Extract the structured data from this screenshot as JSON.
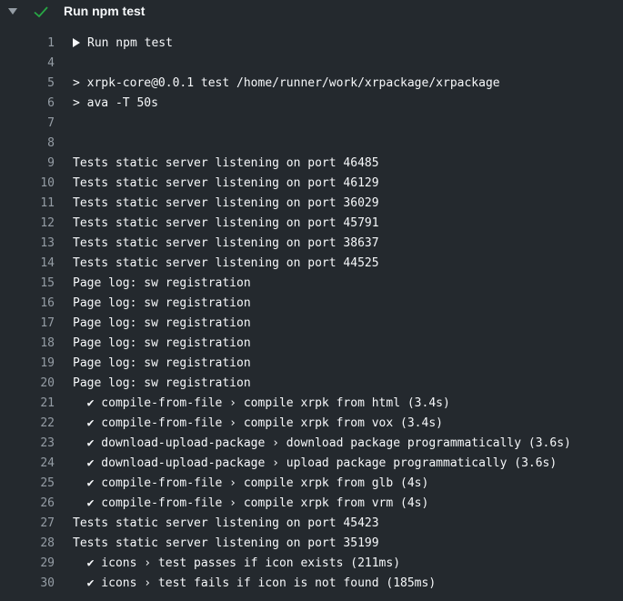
{
  "step": {
    "title": "Run npm test",
    "status": "success",
    "status_color": "#28a745",
    "expanded": true
  },
  "log": [
    {
      "n": "1",
      "text": "Run npm test",
      "group": true
    },
    {
      "n": "4",
      "text": ""
    },
    {
      "n": "5",
      "text": "> xrpk-core@0.0.1 test /home/runner/work/xrpackage/xrpackage"
    },
    {
      "n": "6",
      "text": "> ava -T 50s"
    },
    {
      "n": "7",
      "text": ""
    },
    {
      "n": "8",
      "text": ""
    },
    {
      "n": "9",
      "text": "Tests static server listening on port 46485"
    },
    {
      "n": "10",
      "text": "Tests static server listening on port 46129"
    },
    {
      "n": "11",
      "text": "Tests static server listening on port 36029"
    },
    {
      "n": "12",
      "text": "Tests static server listening on port 45791"
    },
    {
      "n": "13",
      "text": "Tests static server listening on port 38637"
    },
    {
      "n": "14",
      "text": "Tests static server listening on port 44525"
    },
    {
      "n": "15",
      "text": "Page log: sw registration"
    },
    {
      "n": "16",
      "text": "Page log: sw registration"
    },
    {
      "n": "17",
      "text": "Page log: sw registration"
    },
    {
      "n": "18",
      "text": "Page log: sw registration"
    },
    {
      "n": "19",
      "text": "Page log: sw registration"
    },
    {
      "n": "20",
      "text": "Page log: sw registration"
    },
    {
      "n": "21",
      "text": "  ✔ compile-from-file › compile xrpk from html (3.4s)"
    },
    {
      "n": "22",
      "text": "  ✔ compile-from-file › compile xrpk from vox (3.4s)"
    },
    {
      "n": "23",
      "text": "  ✔ download-upload-package › download package programmatically (3.6s)"
    },
    {
      "n": "24",
      "text": "  ✔ download-upload-package › upload package programmatically (3.6s)"
    },
    {
      "n": "25",
      "text": "  ✔ compile-from-file › compile xrpk from glb (4s)"
    },
    {
      "n": "26",
      "text": "  ✔ compile-from-file › compile xrpk from vrm (4s)"
    },
    {
      "n": "27",
      "text": "Tests static server listening on port 45423"
    },
    {
      "n": "28",
      "text": "Tests static server listening on port 35199"
    },
    {
      "n": "29",
      "text": "  ✔ icons › test passes if icon exists (211ms)"
    },
    {
      "n": "30",
      "text": "  ✔ icons › test fails if icon is not found (185ms)"
    }
  ]
}
